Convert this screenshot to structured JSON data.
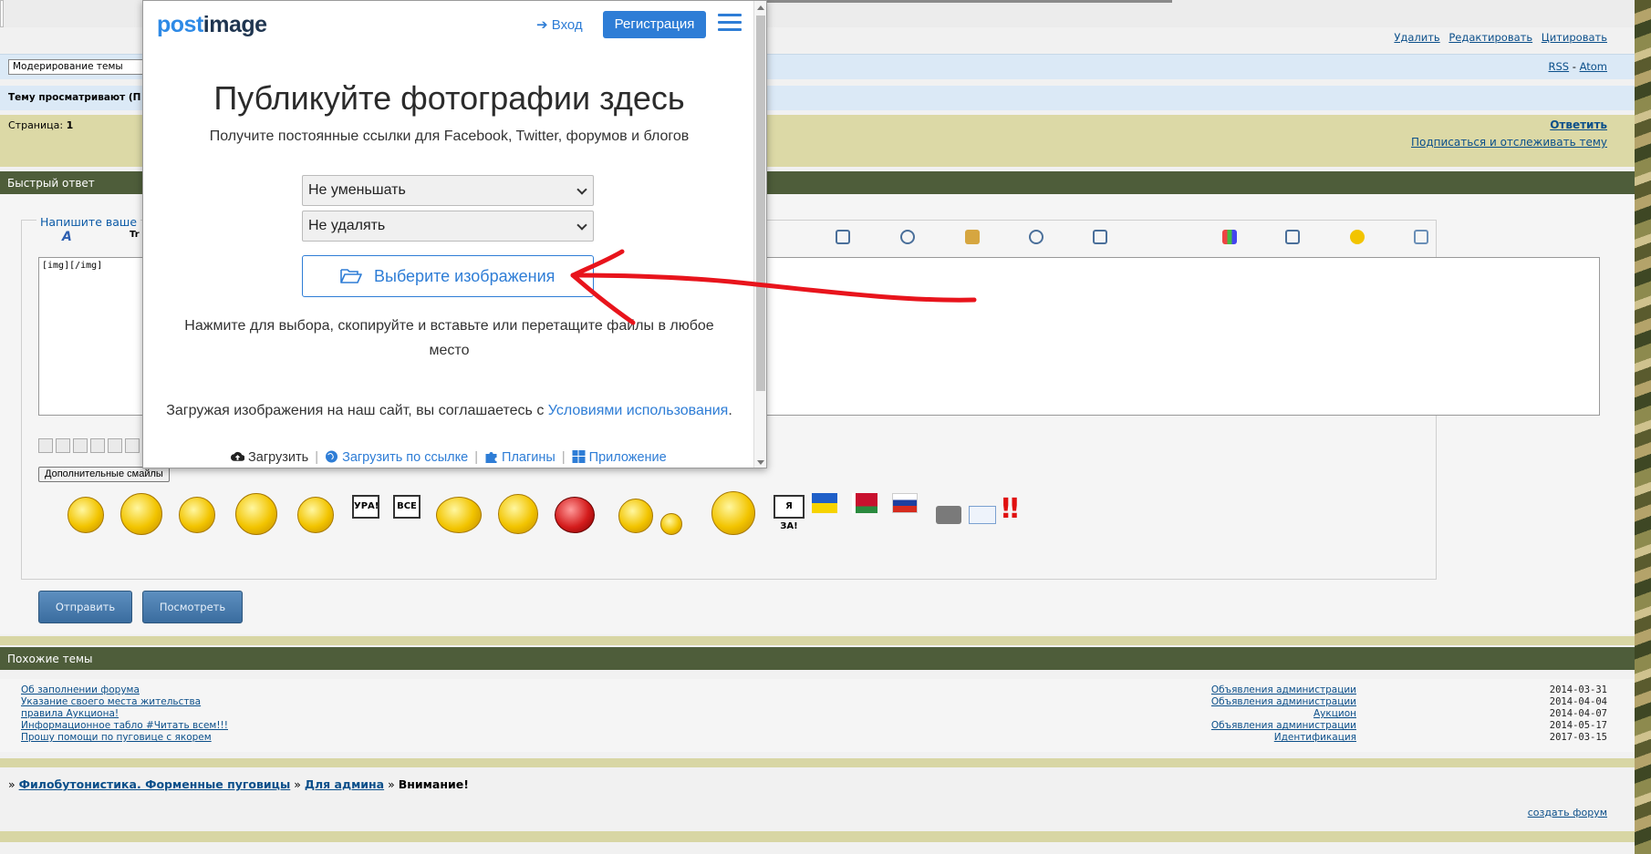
{
  "forum": {
    "post_actions": [
      "Удалить",
      "Редактировать",
      "Цитировать"
    ],
    "moderation_select": "Модерирование темы",
    "feeds": {
      "rss": "RSS",
      "sep": "-",
      "atom": "Atom"
    },
    "viewers_label": "Тему просматривают (П",
    "pages_label": "Страница:",
    "pages_value": "1",
    "reply_link": "Ответить",
    "subscribe_link": "Подписаться и отслеживать тему",
    "quick_reply_title": "Быстрый ответ",
    "legend": "Напишите ваше",
    "editor_value": "[img][/img]",
    "more_smileys": "Дополнительные смайлы",
    "signs": [
      "УРА!",
      "ВСЕ",
      "Я ЗА!"
    ],
    "send_button": "Отправить",
    "preview_button": "Посмотреть",
    "similar_title": "Похожие темы",
    "similar_topics": [
      {
        "title": "Об заполнении форума",
        "forum": "Объявления администрации",
        "date": "2014-03-31"
      },
      {
        "title": "Указание своего места жительства",
        "forum": "Объявления администрации",
        "date": "2014-04-04"
      },
      {
        "title": "правила Аукциона!",
        "forum": "Аукцион",
        "date": "2014-04-07"
      },
      {
        "title": "Информационное табло #Читать всем!!!",
        "forum": "Объявления администрации",
        "date": "2014-05-17"
      },
      {
        "title": "Прошу помощи по пуговице с якорем",
        "forum": "Идентификация",
        "date": "2017-03-15"
      }
    ],
    "breadcrumb": [
      "Филобутонистика. Форменные пуговицы",
      "Для админа",
      "Внимание!"
    ],
    "breadcrumb_sep": "»",
    "create_forum": "создать форум"
  },
  "popup": {
    "logo_part1": "post",
    "logo_part2": "image",
    "login": "Вход",
    "register": "Регистрация",
    "headline": "Публикуйте фотографии здесь",
    "subline": "Получите постоянные ссылки для Facebook, Twitter, форумов и блогов",
    "resize_select": "Не уменьшать",
    "delete_select": "Не удалять",
    "choose_button": "Выберите изображения",
    "hint": "Нажмите для выбора, скопируйте и вставьте или перетащите файлы в любое место",
    "terms_prefix": "Загружая изображения на наш сайт, вы соглашаетесь с ",
    "terms_link": "Условиями использования",
    "terms_suffix": ".",
    "bottom_links": {
      "upload": "Загрузить",
      "upload_by_link": "Загрузить по ссылке",
      "plugins": "Плагины",
      "app": "Приложение"
    }
  },
  "colors": {
    "accent_blue": "#2e7dd6",
    "forum_green": "#4e5d3a",
    "forum_olive": "#dcd9a6",
    "annotation_red": "#e8141c"
  },
  "icons": [
    "sign-in-icon",
    "hamburger-menu-icon",
    "folder-open-icon",
    "cloud-upload-icon",
    "globe-icon",
    "puzzle-icon",
    "windows-icon"
  ]
}
